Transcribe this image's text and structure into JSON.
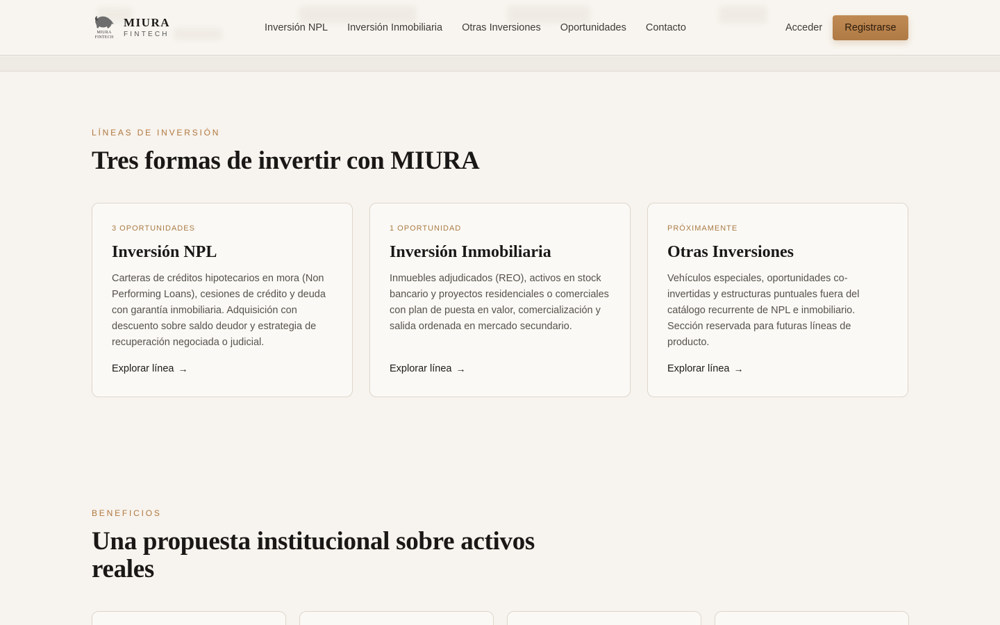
{
  "header": {
    "logo": {
      "name": "MIURA",
      "sub": "FINTECH",
      "mini": "MIURA FINTECH",
      "icon": "bull-icon"
    },
    "nav": [
      {
        "label": "Inversión NPL"
      },
      {
        "label": "Inversión Inmobiliaria"
      },
      {
        "label": "Otras Inversiones"
      },
      {
        "label": "Oportunidades"
      },
      {
        "label": "Contacto"
      }
    ],
    "login_label": "Acceder",
    "register_label": "Registrarse"
  },
  "lines_section": {
    "eyebrow": "LÍNEAS DE INVERSIÓN",
    "title": "Tres formas de invertir con MIURA",
    "cards": [
      {
        "tag": "3 OPORTUNIDADES",
        "title": "Inversión NPL",
        "description": "Carteras de créditos hipotecarios en mora (Non Performing Loans), cesiones de crédito y deuda con garantía inmobiliaria. Adquisición con descuento sobre saldo deudor y estrategia de recuperación negociada o judicial.",
        "link": "Explorar línea",
        "arrow": "→"
      },
      {
        "tag": "1 OPORTUNIDAD",
        "title": "Inversión Inmobiliaria",
        "description": "Inmuebles adjudicados (REO), activos en stock bancario y proyectos residenciales o comerciales con plan de puesta en valor, comercialización y salida ordenada en mercado secundario.",
        "link": "Explorar línea",
        "arrow": "→"
      },
      {
        "tag": "PRÓXIMAMENTE",
        "title": "Otras Inversiones",
        "description": "Vehículos especiales, oportunidades co-invertidas y estructuras puntuales fuera del catálogo recurrente de NPL e inmobiliario. Sección reservada para futuras líneas de producto.",
        "link": "Explorar línea",
        "arrow": "→"
      }
    ]
  },
  "benefits_section": {
    "eyebrow": "BENEFICIOS",
    "title": "Una propuesta institucional sobre activos reales"
  },
  "colors": {
    "background": "#f7f3ee",
    "accent": "#b07a45",
    "card_bg": "#fbf9f5"
  }
}
